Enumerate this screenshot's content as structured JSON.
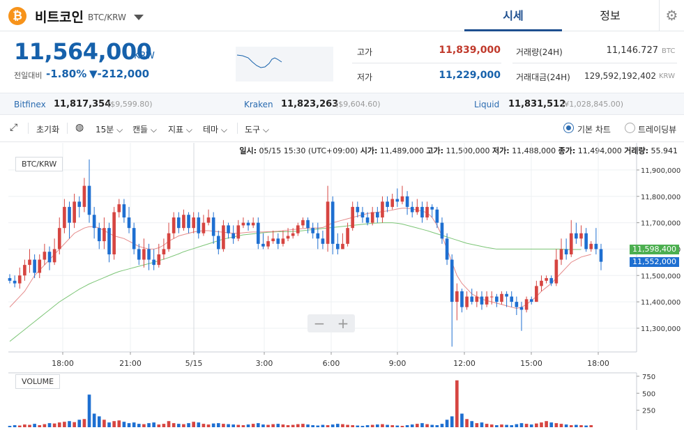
{
  "header": {
    "coin_symbol": "₿",
    "coin_name": "비트코인",
    "pair": "BTC/KRW",
    "tabs": [
      {
        "label": "시세"
      },
      {
        "label": "정보"
      }
    ]
  },
  "summary": {
    "price": "11,564,000",
    "unit": "KRW",
    "change_label": "전일대비",
    "change_rate": "-1.80%",
    "change_amount": "▼-212,000",
    "high_label": "고가",
    "high": "11,839,000",
    "low_label": "저가",
    "low": "11,229,000",
    "volume_label": "거래량(24H)",
    "volume": "11,146.727",
    "volume_unit": "BTC",
    "amount_label": "거래대금(24H)",
    "amount": "129,592,192,402",
    "amount_unit": "KRW"
  },
  "exchanges": [
    {
      "name": "Bitfinex",
      "price": "11,817,354",
      "sub": "($9,599.80)"
    },
    {
      "name": "Kraken",
      "price": "11,823,263",
      "sub": "($9,604.60)"
    },
    {
      "name": "Liquid",
      "price": "11,831,512",
      "sub": "(¥1,028,845.00)"
    }
  ],
  "toolbar": {
    "reset": "초기화",
    "interval": "15분",
    "candle": "캔들",
    "indicator": "지표",
    "theme": "테마",
    "tools": "도구",
    "basic_chart": "기본 차트",
    "trading_view": "트레이딩뷰"
  },
  "ohlc": {
    "time_label": "일시:",
    "time": "05/15 15:30 (UTC+09:00)",
    "open_label": "시가:",
    "open": "11,489,000",
    "high_label": "고가:",
    "high": "11,500,000",
    "low_label": "저가:",
    "low": "11,488,000",
    "close_label": "종가:",
    "close": "11,494,000",
    "vol_label": "거래량:",
    "vol": "55.941"
  },
  "chart_data": {
    "type": "candlestick",
    "pair_label": "BTC/KRW",
    "volume_label": "VOLUME",
    "price_ticks": [
      "11,900,000",
      "11,800,000",
      "11,700,000",
      "11,600,000",
      "11,500,000",
      "11,400,000",
      "11,300,000"
    ],
    "price_ticks_values": [
      11900000,
      11800000,
      11700000,
      11600000,
      11500000,
      11400000,
      11300000
    ],
    "ylim": [
      11210000,
      11950000
    ],
    "volume_ticks": [
      "750",
      "500",
      "250"
    ],
    "volume_ticks_values": [
      750,
      500,
      250
    ],
    "volume_ylim": [
      0,
      800
    ],
    "x_ticks": [
      "18:00",
      "21:00",
      "5/15",
      "3:00",
      "6:00",
      "9:00",
      "12:00",
      "15:00",
      "18:00"
    ],
    "last_price_tags": [
      {
        "value": "11,598,400",
        "price": 11598400,
        "color": "#4caf50"
      },
      {
        "value": "11,552,000",
        "price": 11552000,
        "color": "#1e6fd1"
      }
    ],
    "up_color": "#d64541",
    "down_color": "#1e6fd1",
    "ma_short_color": "#e58a8a",
    "ma_long_color": "#7cc576",
    "candles": [
      [
        11490000,
        11480000,
        11505000,
        11470000
      ],
      [
        11480000,
        11470000,
        11500000,
        11455000
      ],
      [
        11470000,
        11500000,
        11530000,
        11450000
      ],
      [
        11500000,
        11540000,
        11560000,
        11480000
      ],
      [
        11540000,
        11560000,
        11600000,
        11510000
      ],
      [
        11560000,
        11510000,
        11580000,
        11490000
      ],
      [
        11510000,
        11560000,
        11580000,
        11490000
      ],
      [
        11560000,
        11590000,
        11620000,
        11540000
      ],
      [
        11590000,
        11550000,
        11610000,
        11520000
      ],
      [
        11550000,
        11600000,
        11640000,
        11540000
      ],
      [
        11600000,
        11680000,
        11720000,
        11580000
      ],
      [
        11680000,
        11760000,
        11790000,
        11660000
      ],
      [
        11760000,
        11700000,
        11780000,
        11640000
      ],
      [
        11700000,
        11780000,
        11810000,
        11680000
      ],
      [
        11780000,
        11760000,
        11800000,
        11720000
      ],
      [
        11760000,
        11840000,
        11870000,
        11740000
      ],
      [
        11840000,
        11730000,
        11940000,
        11700000
      ],
      [
        11730000,
        11680000,
        11760000,
        11640000
      ],
      [
        11680000,
        11630000,
        11700000,
        11600000
      ],
      [
        11630000,
        11680000,
        11720000,
        11600000
      ],
      [
        11680000,
        11580000,
        11700000,
        11550000
      ],
      [
        11580000,
        11740000,
        11760000,
        11560000
      ],
      [
        11740000,
        11770000,
        11790000,
        11720000
      ],
      [
        11770000,
        11720000,
        11790000,
        11700000
      ],
      [
        11720000,
        11680000,
        11760000,
        11660000
      ],
      [
        11680000,
        11600000,
        11700000,
        11580000
      ],
      [
        11600000,
        11560000,
        11620000,
        11540000
      ],
      [
        11560000,
        11600000,
        11640000,
        11530000
      ],
      [
        11600000,
        11560000,
        11620000,
        11520000
      ],
      [
        11560000,
        11540000,
        11600000,
        11520000
      ],
      [
        11540000,
        11580000,
        11620000,
        11530000
      ],
      [
        11580000,
        11600000,
        11640000,
        11560000
      ],
      [
        11600000,
        11660000,
        11700000,
        11590000
      ],
      [
        11660000,
        11720000,
        11740000,
        11640000
      ],
      [
        11720000,
        11680000,
        11740000,
        11660000
      ],
      [
        11680000,
        11730000,
        11750000,
        11670000
      ],
      [
        11730000,
        11680000,
        11740000,
        11660000
      ],
      [
        11680000,
        11720000,
        11740000,
        11660000
      ],
      [
        11720000,
        11660000,
        11740000,
        11640000
      ],
      [
        11660000,
        11700000,
        11730000,
        11650000
      ],
      [
        11700000,
        11720000,
        11750000,
        11690000
      ],
      [
        11720000,
        11650000,
        11740000,
        11620000
      ],
      [
        11650000,
        11600000,
        11670000,
        11580000
      ],
      [
        11600000,
        11690000,
        11710000,
        11590000
      ],
      [
        11690000,
        11660000,
        11700000,
        11640000
      ],
      [
        11660000,
        11640000,
        11690000,
        11620000
      ],
      [
        11640000,
        11690000,
        11710000,
        11630000
      ],
      [
        11690000,
        11700000,
        11720000,
        11680000
      ],
      [
        11700000,
        11690000,
        11710000,
        11670000
      ],
      [
        11690000,
        11700000,
        11720000,
        11680000
      ],
      [
        11700000,
        11620000,
        11720000,
        11600000
      ],
      [
        11620000,
        11610000,
        11660000,
        11600000
      ],
      [
        11610000,
        11630000,
        11650000,
        11600000
      ],
      [
        11630000,
        11640000,
        11670000,
        11620000
      ],
      [
        11640000,
        11620000,
        11660000,
        11600000
      ],
      [
        11620000,
        11640000,
        11670000,
        11610000
      ],
      [
        11640000,
        11650000,
        11680000,
        11630000
      ],
      [
        11650000,
        11660000,
        11680000,
        11640000
      ],
      [
        11660000,
        11690000,
        11700000,
        11650000
      ],
      [
        11690000,
        11710000,
        11720000,
        11680000
      ],
      [
        11710000,
        11680000,
        11720000,
        11660000
      ],
      [
        11680000,
        11660000,
        11700000,
        11640000
      ],
      [
        11660000,
        11640000,
        11700000,
        11600000
      ],
      [
        11640000,
        11620000,
        11670000,
        11600000
      ],
      [
        11620000,
        11780000,
        11840000,
        11590000
      ],
      [
        11780000,
        11620000,
        11800000,
        11580000
      ],
      [
        11620000,
        11600000,
        11660000,
        11580000
      ],
      [
        11600000,
        11620000,
        11660000,
        11600000
      ],
      [
        11620000,
        11680000,
        11700000,
        11610000
      ],
      [
        11680000,
        11760000,
        11780000,
        11670000
      ],
      [
        11760000,
        11740000,
        11780000,
        11720000
      ],
      [
        11740000,
        11720000,
        11760000,
        11700000
      ],
      [
        11720000,
        11700000,
        11740000,
        11690000
      ],
      [
        11700000,
        11740000,
        11760000,
        11690000
      ],
      [
        11740000,
        11720000,
        11760000,
        11700000
      ],
      [
        11720000,
        11780000,
        11800000,
        11700000
      ],
      [
        11780000,
        11760000,
        11800000,
        11740000
      ],
      [
        11760000,
        11790000,
        11810000,
        11750000
      ],
      [
        11790000,
        11780000,
        11830000,
        11760000
      ],
      [
        11780000,
        11800000,
        11840000,
        11770000
      ],
      [
        11800000,
        11760000,
        11820000,
        11730000
      ],
      [
        11760000,
        11740000,
        11780000,
        11720000
      ],
      [
        11740000,
        11760000,
        11790000,
        11730000
      ],
      [
        11760000,
        11720000,
        11780000,
        11700000
      ],
      [
        11720000,
        11760000,
        11780000,
        11710000
      ],
      [
        11760000,
        11750000,
        11770000,
        11720000
      ],
      [
        11750000,
        11700000,
        11760000,
        11680000
      ],
      [
        11700000,
        11640000,
        11720000,
        11620000
      ],
      [
        11640000,
        11560000,
        11660000,
        11540000
      ],
      [
        11560000,
        11400000,
        11580000,
        11230000
      ],
      [
        11400000,
        11440000,
        11470000,
        11330000
      ],
      [
        11440000,
        11380000,
        11450000,
        11360000
      ],
      [
        11380000,
        11420000,
        11440000,
        11370000
      ],
      [
        11420000,
        11400000,
        11450000,
        11390000
      ],
      [
        11400000,
        11420000,
        11440000,
        11380000
      ],
      [
        11420000,
        11390000,
        11440000,
        11370000
      ],
      [
        11390000,
        11420000,
        11440000,
        11380000
      ],
      [
        11420000,
        11420000,
        11440000,
        11390000
      ],
      [
        11420000,
        11400000,
        11430000,
        11380000
      ],
      [
        11400000,
        11430000,
        11440000,
        11390000
      ],
      [
        11430000,
        11420000,
        11440000,
        11380000
      ],
      [
        11420000,
        11400000,
        11440000,
        11380000
      ],
      [
        11400000,
        11380000,
        11420000,
        11350000
      ],
      [
        11380000,
        11370000,
        11400000,
        11290000
      ],
      [
        11370000,
        11410000,
        11420000,
        11360000
      ],
      [
        11410000,
        11400000,
        11420000,
        11390000
      ],
      [
        11400000,
        11460000,
        11480000,
        11400000
      ],
      [
        11460000,
        11480000,
        11500000,
        11440000
      ],
      [
        11480000,
        11490000,
        11500000,
        11470000
      ],
      [
        11490000,
        11470000,
        11500000,
        11460000
      ],
      [
        11470000,
        11560000,
        11600000,
        11460000
      ],
      [
        11560000,
        11600000,
        11640000,
        11540000
      ],
      [
        11600000,
        11580000,
        11640000,
        11560000
      ],
      [
        11580000,
        11660000,
        11710000,
        11570000
      ],
      [
        11660000,
        11640000,
        11700000,
        11620000
      ],
      [
        11640000,
        11660000,
        11690000,
        11610000
      ],
      [
        11660000,
        11600000,
        11680000,
        11590000
      ],
      [
        11600000,
        11620000,
        11630000,
        11590000
      ],
      [
        11620000,
        11600000,
        11680000,
        11580000
      ],
      [
        11600000,
        11552000,
        11620000,
        11520000
      ]
    ],
    "ma_short": [
      11380000,
      11400000,
      11420000,
      11440000,
      11470000,
      11500000,
      11520000,
      11540000,
      11560000,
      11580000,
      11600000,
      11620000,
      11640000,
      11660000,
      11670000,
      11680000,
      11685000,
      11685000,
      11680000,
      11670000,
      11660000,
      11650000,
      11645000,
      11640000,
      11630000,
      11620000,
      11610000,
      11605000,
      11600000,
      11600000,
      11605000,
      11615000,
      11630000,
      11640000,
      11650000,
      11655000,
      11660000,
      11665000,
      11668000,
      11670000,
      11670000,
      11668000,
      11666000,
      11664000,
      11662000,
      11660000,
      11660000,
      11662000,
      11664000,
      11665000,
      11665000,
      11665000,
      11666000,
      11667000,
      11668000,
      11670000,
      11672000,
      11674000,
      11676000,
      11678000,
      11679000,
      11680000,
      11680000,
      11682000,
      11690000,
      11700000,
      11705000,
      11710000,
      11715000,
      11720000,
      11725000,
      11730000,
      11735000,
      11738000,
      11740000,
      11742000,
      11745000,
      11748000,
      11752000,
      11755000,
      11755000,
      11752000,
      11748000,
      11744000,
      11738000,
      11720000,
      11690000,
      11650000,
      11600000,
      11550000,
      11500000,
      11470000,
      11450000,
      11430000,
      11420000,
      11410000,
      11405000,
      11400000,
      11395000,
      11390000,
      11385000,
      11380000,
      11375000,
      11380000,
      11390000,
      11405000,
      11420000,
      11440000,
      11455000,
      11470000,
      11490000,
      11510000,
      11530000,
      11550000,
      11560000,
      11570000,
      11575000,
      11580000
    ],
    "ma_long": [
      11250000,
      11265000,
      11280000,
      11295000,
      11310000,
      11325000,
      11340000,
      11355000,
      11370000,
      11385000,
      11400000,
      11412000,
      11424000,
      11436000,
      11448000,
      11458000,
      11468000,
      11476000,
      11484000,
      11492000,
      11500000,
      11508000,
      11515000,
      11520000,
      11525000,
      11530000,
      11535000,
      11540000,
      11545000,
      11550000,
      11556000,
      11562000,
      11568000,
      11575000,
      11582000,
      11590000,
      11596000,
      11602000,
      11608000,
      11614000,
      11620000,
      11626000,
      11632000,
      11638000,
      11642000,
      11646000,
      11650000,
      11654000,
      11656000,
      11658000,
      11660000,
      11662000,
      11664000,
      11665000,
      11666000,
      11666000,
      11666000,
      11667000,
      11668000,
      11670000,
      11672000,
      11674000,
      11676000,
      11678000,
      11680000,
      11682000,
      11684000,
      11686000,
      11688000,
      11690000,
      11692000,
      11694000,
      11696000,
      11698000,
      11699000,
      11700000,
      11700000,
      11700000,
      11698000,
      11695000,
      11690000,
      11685000,
      11680000,
      11675000,
      11670000,
      11664000,
      11658000,
      11652000,
      11646000,
      11640000,
      11634000,
      11628000,
      11622000,
      11618000,
      11614000,
      11610000,
      11606000,
      11603000,
      11600000,
      11600000,
      11600000,
      11600000,
      11600000,
      11600000,
      11600000,
      11600000,
      11600000,
      11600000,
      11600000,
      11600000,
      11600000,
      11600000,
      11598400,
      11598400,
      11598400,
      11598400
    ],
    "volumes": [
      20,
      30,
      25,
      40,
      35,
      50,
      30,
      45,
      60,
      55,
      70,
      80,
      90,
      75,
      110,
      120,
      480,
      200,
      160,
      110,
      70,
      90,
      100,
      80,
      60,
      70,
      50,
      45,
      60,
      70,
      40,
      50,
      90,
      60,
      50,
      45,
      60,
      80,
      70,
      50,
      40,
      55,
      60,
      50,
      45,
      40,
      35,
      30,
      40,
      50,
      60,
      40,
      35,
      45,
      50,
      40,
      30,
      35,
      45,
      50,
      40,
      30,
      25,
      35,
      30,
      40,
      50,
      45,
      35,
      30,
      25,
      20,
      30,
      35,
      40,
      45,
      35,
      30,
      25,
      20,
      30,
      40,
      50,
      60,
      45,
      35,
      30,
      50,
      110,
      160,
      690,
      200,
      120,
      90,
      60,
      70,
      50,
      40,
      30,
      40,
      35,
      30,
      45,
      60,
      50,
      40,
      55,
      70,
      90,
      70,
      60,
      50,
      40,
      30,
      35,
      30,
      25,
      30
    ]
  }
}
